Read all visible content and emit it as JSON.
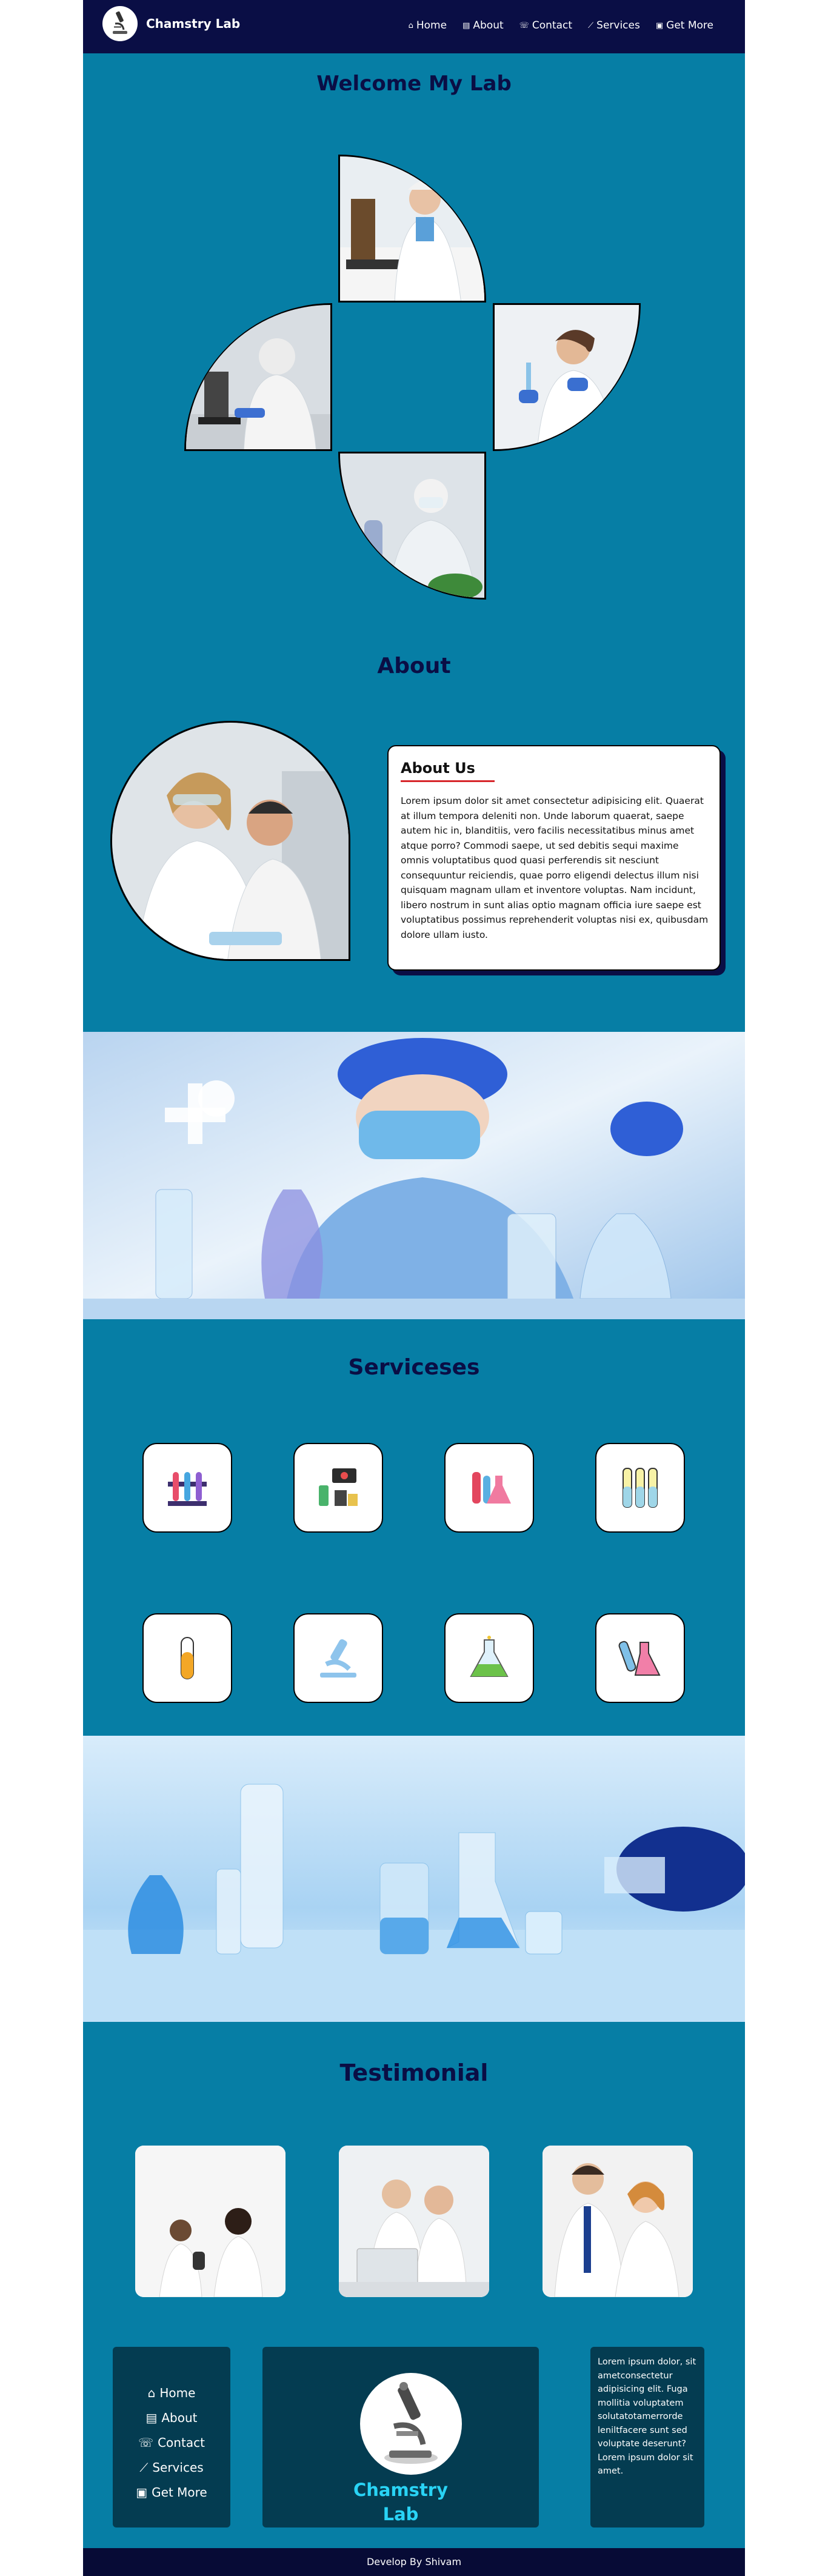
{
  "header": {
    "brand": "Chamstry Lab",
    "nav": [
      {
        "label": "Home",
        "icon": "home-icon",
        "glyph": "⌂"
      },
      {
        "label": "About",
        "icon": "id-card-icon",
        "glyph": "▤"
      },
      {
        "label": "Contact",
        "icon": "phone-icon",
        "glyph": "☏"
      },
      {
        "label": "Services",
        "icon": "chart-line-icon",
        "glyph": "⟋"
      },
      {
        "label": "Get More",
        "icon": "box-icon",
        "glyph": "▣"
      }
    ]
  },
  "welcome": {
    "title": "Welcome My Lab"
  },
  "about": {
    "title": "About",
    "card_title": "About Us",
    "card_text": "Lorem ipsum dolor sit amet consectetur adipisicing elit. Quaerat at illum tempora deleniti non. Unde laborum quaerat, saepe autem hic in, blanditiis, vero facilis necessitatibus minus amet atque porro? Commodi saepe, ut sed debitis sequi maxime omnis voluptatibus quod quasi perferendis sit nesciunt consequuntur reiciendis, quae porro eligendi delectus illum nisi quisquam magnam ullam et inventore voluptas. Nam incidunt, libero nostrum in sunt alias optio magnam officia iure saepe est voluptatibus possimus reprehenderit voluptas nisi ex, quibusdam dolore ullam iusto."
  },
  "services": {
    "title": "Serviceses",
    "icons": [
      "test-tubes-rack-icon",
      "lab-equipment-icon",
      "flask-tubes-icon",
      "yellow-test-tubes-icon",
      "test-tube-icon",
      "microscope-icon",
      "green-flask-icon",
      "pink-flask-icon"
    ]
  },
  "testimonial": {
    "title": "Testimonial"
  },
  "footer": {
    "links": [
      {
        "label": "Home",
        "glyph": "⌂"
      },
      {
        "label": "About",
        "glyph": "▤"
      },
      {
        "label": "Contact",
        "glyph": "☏"
      },
      {
        "label": "Services",
        "glyph": "⟋"
      },
      {
        "label": "Get More",
        "glyph": "▣"
      }
    ],
    "brand_line1": "Chamstry",
    "brand_line2": "Lab",
    "text": "Lorem ipsum dolor, sit ametconsectetur adipisicing elit. Fuga mollitia voluptatem solutatotamerrorde leniltfacere sunt sed voluptate deserunt? Lorem ipsum dolor sit amet.",
    "credit": "Develop By Shivam"
  },
  "colors": {
    "page": "#067ea5",
    "navy": "#0a0e45",
    "footer_box": "#043c51",
    "footer_brand": "#29d3f5"
  }
}
